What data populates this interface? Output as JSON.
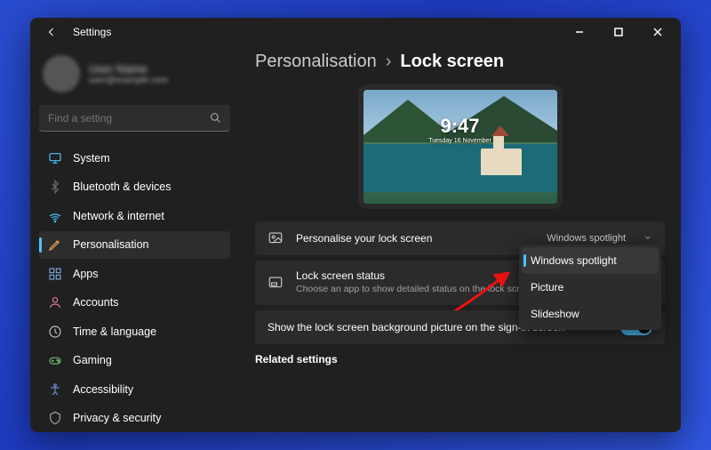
{
  "title": "Settings",
  "breadcrumb": {
    "parent": "Personalisation",
    "current": "Lock screen"
  },
  "search": {
    "placeholder": "Find a setting"
  },
  "profile": {
    "name": "User Name",
    "email": "user@example.com"
  },
  "preview": {
    "time": "9:47",
    "date": "Tuesday 16 November"
  },
  "sidebar": {
    "items": [
      {
        "label": "System",
        "icon": "system-icon",
        "color": "#4cc2ff"
      },
      {
        "label": "Bluetooth & devices",
        "icon": "bluetooth-icon",
        "color": "#6a6a6a"
      },
      {
        "label": "Network & internet",
        "icon": "network-icon",
        "color": "#4cc2ff"
      },
      {
        "label": "Personalisation",
        "icon": "personalise-icon",
        "color": "#e39b56"
      },
      {
        "label": "Apps",
        "icon": "apps-icon",
        "color": "#7aa0d6"
      },
      {
        "label": "Accounts",
        "icon": "accounts-icon",
        "color": "#d77a8a"
      },
      {
        "label": "Time & language",
        "icon": "time-icon",
        "color": "#c0c0c0"
      },
      {
        "label": "Gaming",
        "icon": "gaming-icon",
        "color": "#6fb36f"
      },
      {
        "label": "Accessibility",
        "icon": "accessibility-icon",
        "color": "#6a8cd6"
      },
      {
        "label": "Privacy & security",
        "icon": "privacy-icon",
        "color": "#a0a0a0"
      }
    ],
    "selected_index": 3
  },
  "settings": {
    "personalise_title": "Personalise your lock screen",
    "personalise_value": "Windows spotlight",
    "status_title": "Lock screen status",
    "status_desc": "Choose an app to show detailed status on the lock screen",
    "signin_title": "Show the lock screen background picture on the sign-in screen",
    "signin_value": "On",
    "related_title": "Related settings"
  },
  "dropdown": {
    "options": [
      "Windows spotlight",
      "Picture",
      "Slideshow"
    ],
    "selected_index": 0
  }
}
